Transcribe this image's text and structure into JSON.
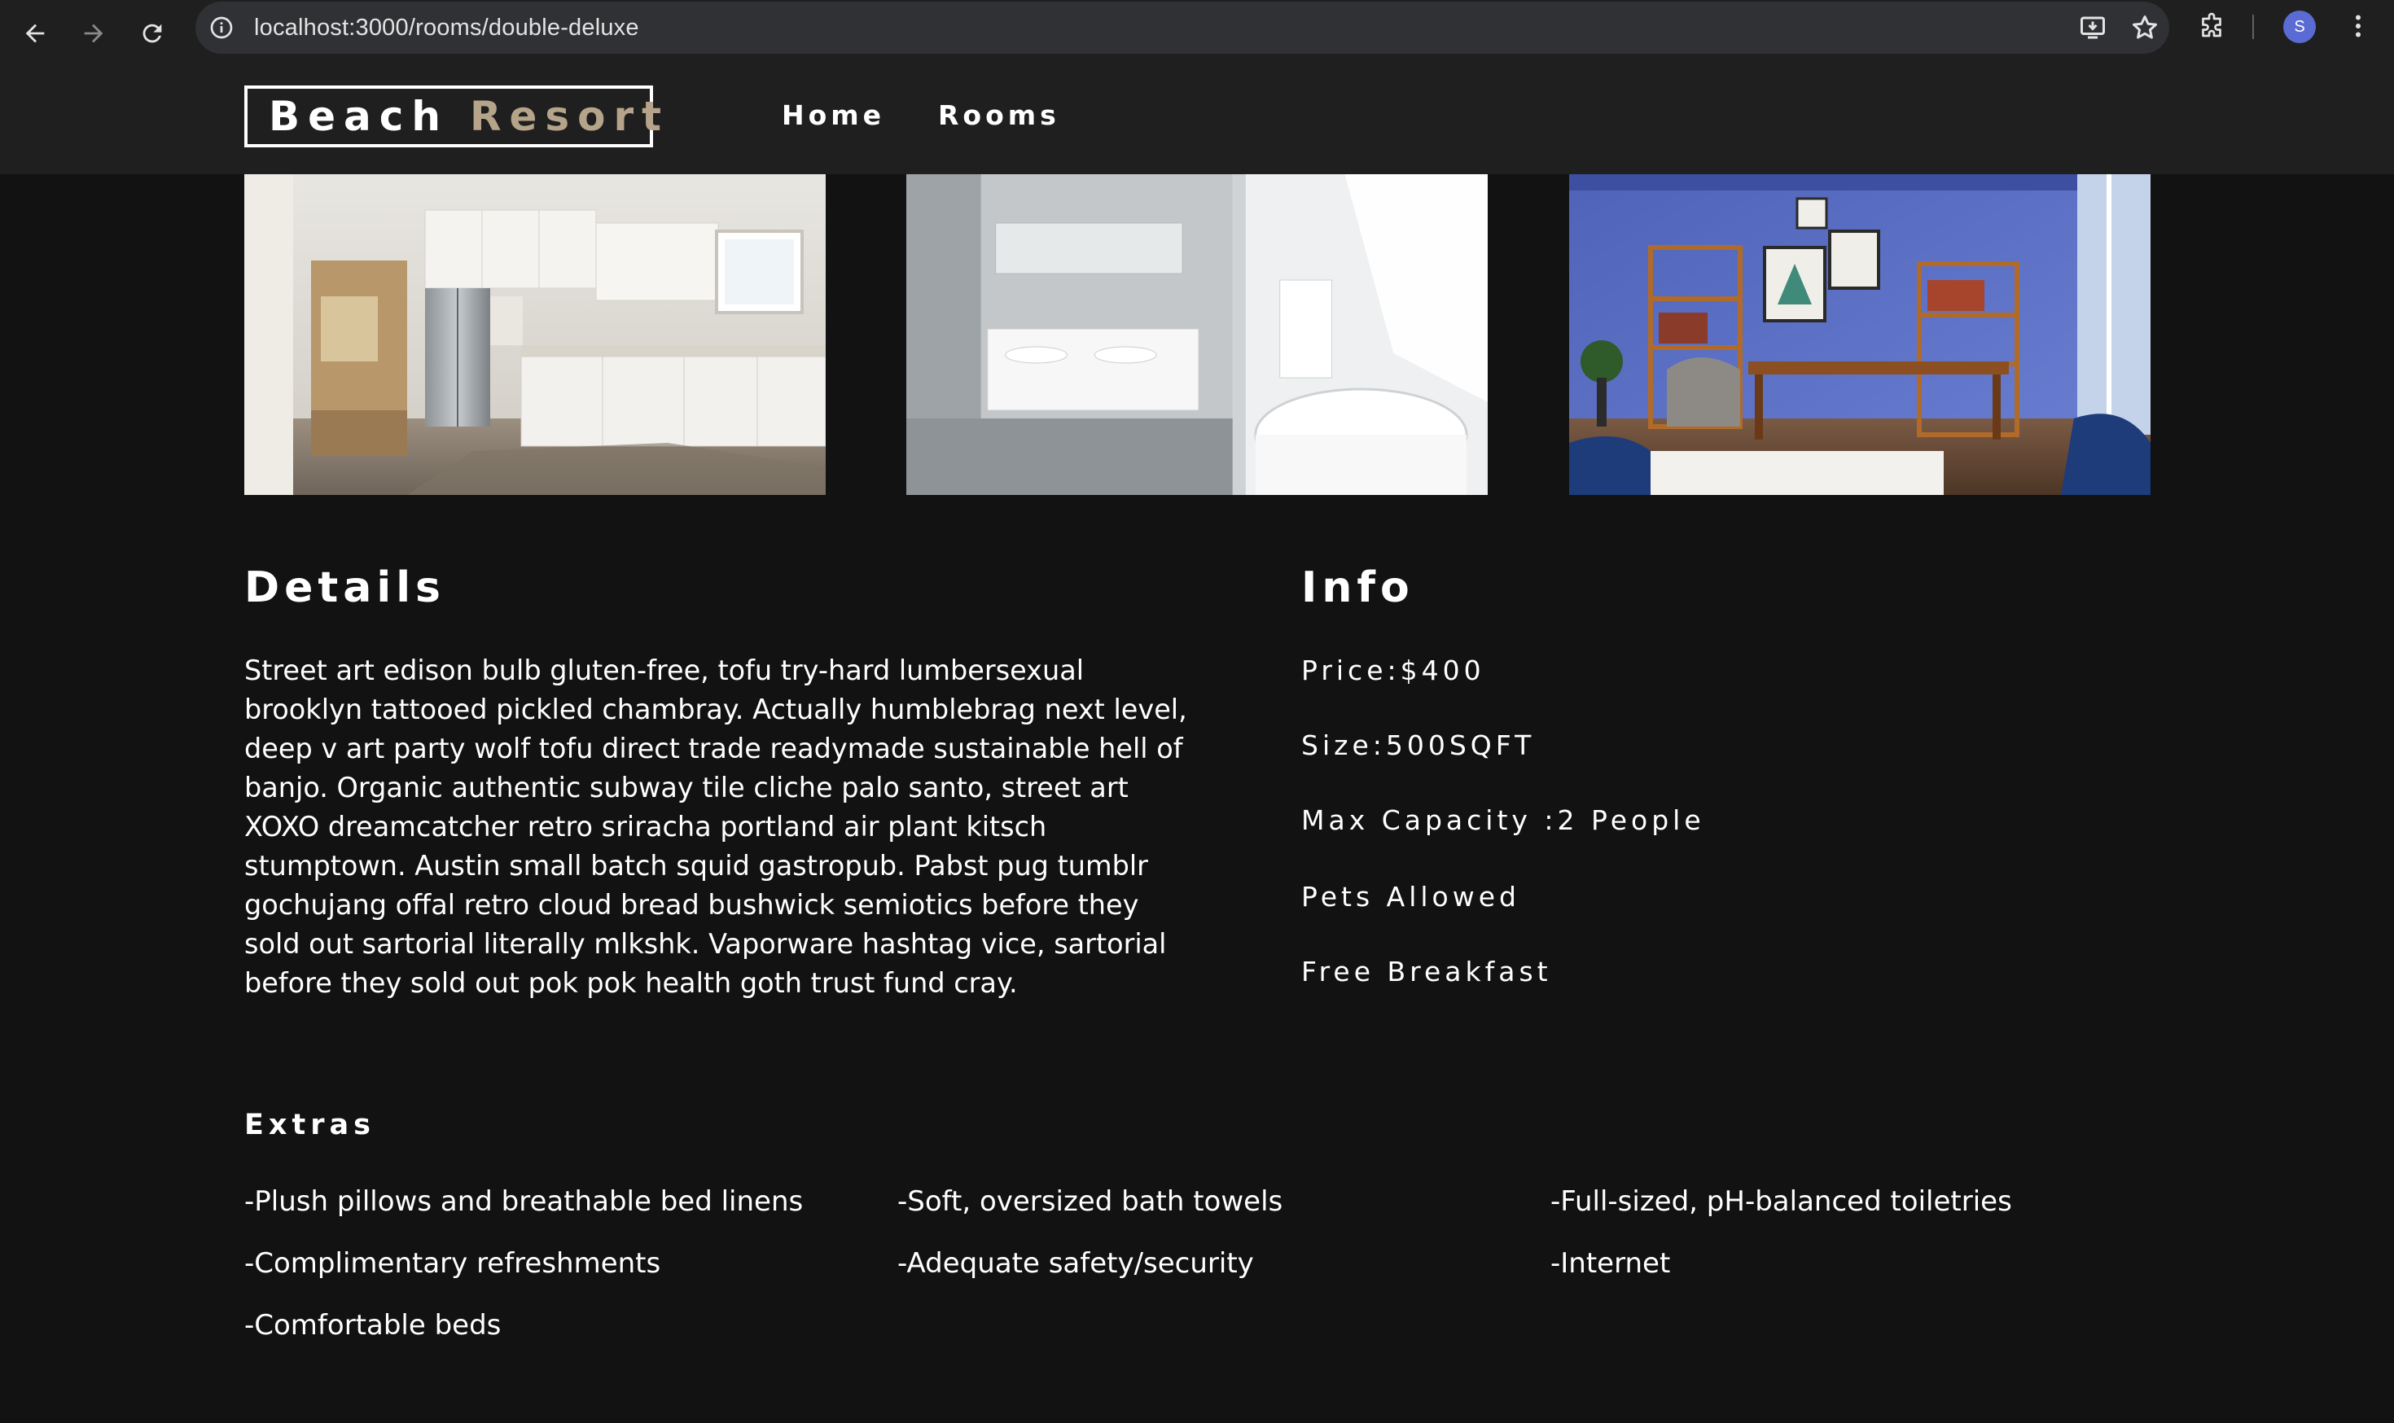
{
  "browser": {
    "url": "localhost:3000/rooms/double-deluxe",
    "profile_initial": "S"
  },
  "site": {
    "logo_word1": "Beach",
    "logo_word2": "Resort",
    "nav": [
      {
        "label": "Home"
      },
      {
        "label": "Rooms"
      }
    ]
  },
  "gallery": [
    {
      "subject": "kitchen"
    },
    {
      "subject": "bathroom"
    },
    {
      "subject": "study room"
    }
  ],
  "details": {
    "title": "Details",
    "description": "Street art edison bulb gluten-free, tofu try-hard lumbersexual brooklyn tattooed pickled chambray. Actually humblebrag next level, deep v art party wolf tofu direct trade readymade sustainable hell of banjo. Organic authentic subway tile cliche palo santo, street art XOXO dreamcatcher retro sriracha portland air plant kitsch stumptown. Austin small batch squid gastropub. Pabst pug tumblr gochujang offal retro cloud bread bushwick semiotics before they sold out sartorial literally mlkshk. Vaporware hashtag vice, sartorial before they sold out pok pok health goth trust fund cray."
  },
  "info": {
    "title": "Info",
    "price": "Price:$400",
    "size": "Size:500SQFT",
    "capacity": "Max Capacity :2 People",
    "pets": "Pets Allowed",
    "breakfast": "Free Breakfast"
  },
  "extras": {
    "title": "Extras",
    "items": [
      "-Plush pillows and breathable bed linens",
      "-Soft, oversized bath towels",
      "-Full-sized, pH-balanced toiletries",
      "-Complimentary refreshments",
      "-Adequate safety/security",
      "-Internet",
      "-Comfortable beds"
    ]
  },
  "colors": {
    "page_bg": "#121212",
    "nav_bg": "#1f1f1f",
    "logo_accent": "#b5a48a"
  }
}
